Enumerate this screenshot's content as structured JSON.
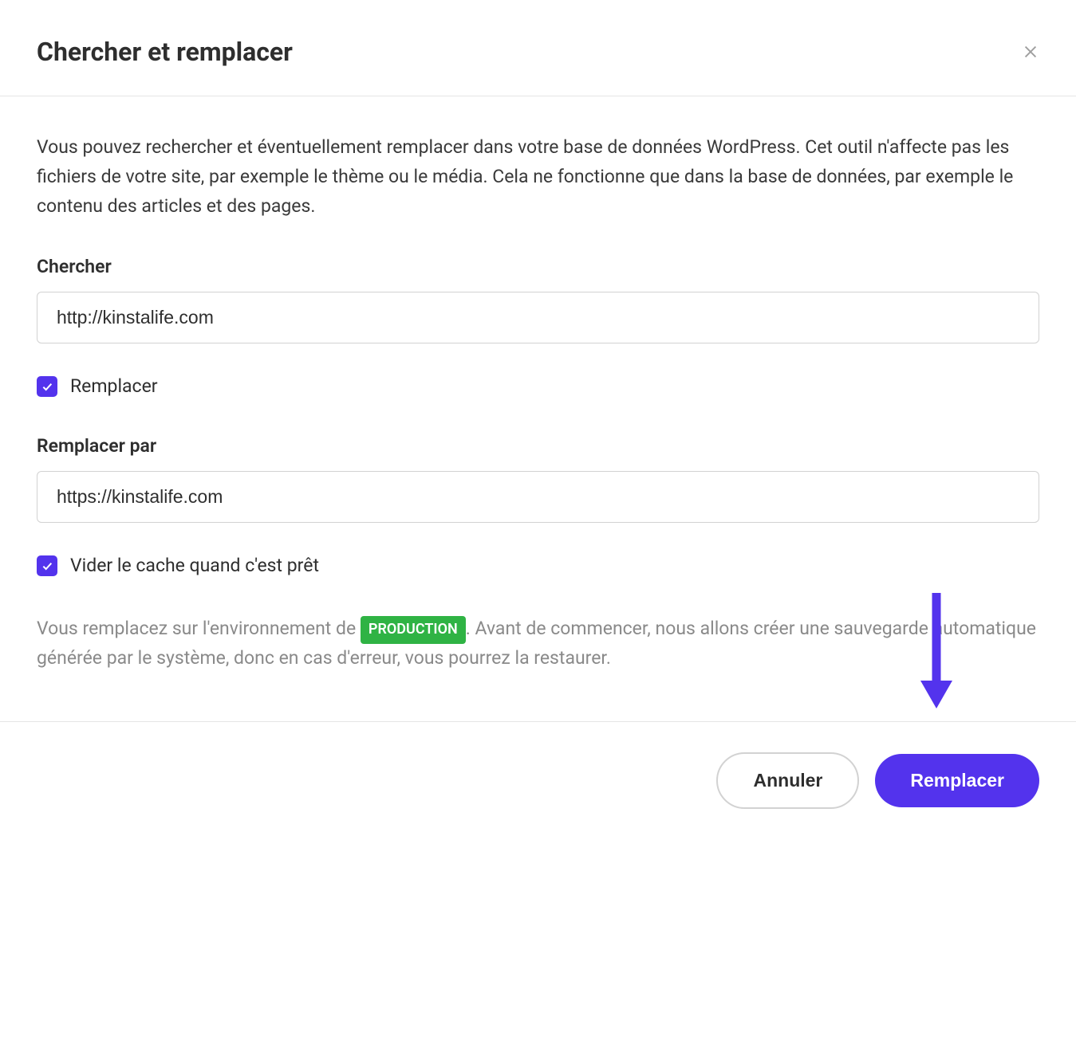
{
  "header": {
    "title": "Chercher et remplacer"
  },
  "body": {
    "description": "Vous pouvez rechercher et éventuellement remplacer dans votre base de données WordPress. Cet outil n'affecte pas les fichiers de votre site, par exemple le thème ou le média. Cela ne fonctionne que dans la base de données, par exemple le contenu des articles et des pages.",
    "search": {
      "label": "Chercher",
      "value": "http://kinstalife.com"
    },
    "replace_checkbox": {
      "label": "Remplacer",
      "checked": true
    },
    "replace_with": {
      "label": "Remplacer par",
      "value": "https://kinstalife.com"
    },
    "clear_cache_checkbox": {
      "label": "Vider le cache quand c'est prêt",
      "checked": true
    },
    "warning": {
      "before_badge": "Vous remplacez sur l'environnement de ",
      "badge": "PRODUCTION",
      "after_badge": ". Avant de commencer, nous allons créer une sauvegarde automatique générée par le système, donc en cas d'erreur, vous pourrez la restaurer."
    }
  },
  "footer": {
    "cancel_label": "Annuler",
    "replace_label": "Remplacer"
  },
  "colors": {
    "accent": "#5333ed",
    "badge_bg": "#2fb344"
  }
}
